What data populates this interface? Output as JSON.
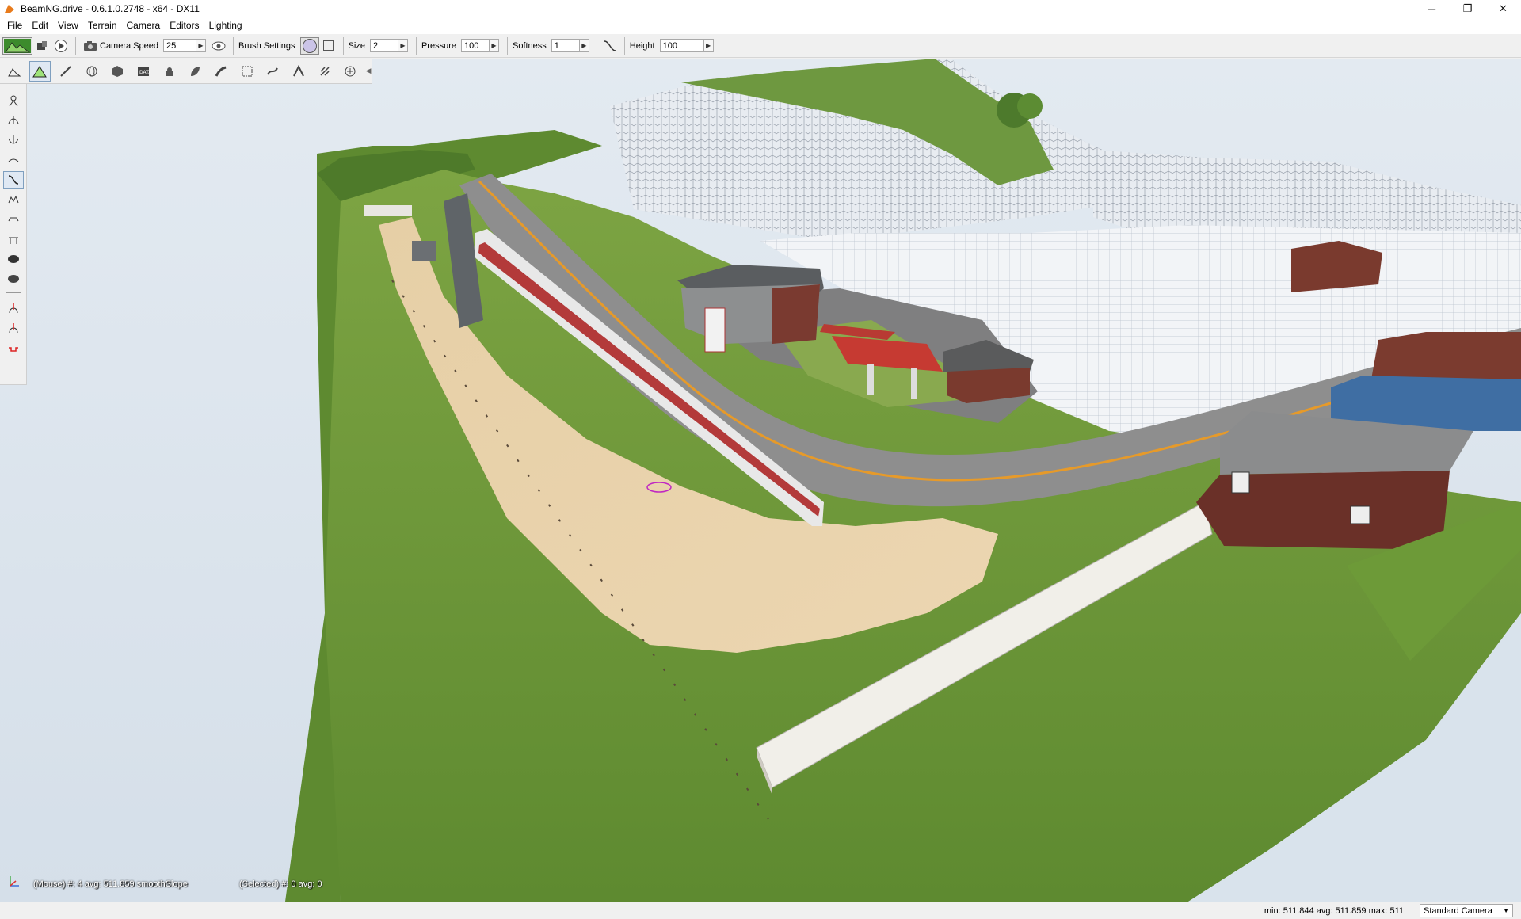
{
  "window": {
    "title": "BeamNG.drive - 0.6.1.0.2748 - x64 - DX11",
    "controls": {
      "minimize": "─",
      "restore": "❐",
      "close": "✕"
    }
  },
  "menu": [
    "File",
    "Edit",
    "View",
    "Terrain",
    "Camera",
    "Editors",
    "Lighting"
  ],
  "toolbar": {
    "camera_speed_label": "Camera Speed",
    "camera_speed_value": "25",
    "brush_settings_label": "Brush Settings",
    "size_label": "Size",
    "size_value": "2",
    "pressure_label": "Pressure",
    "pressure_value": "100",
    "softness_label": "Softness",
    "softness_value": "1",
    "height_label": "Height",
    "height_value": "100"
  },
  "viewport": {
    "mouse_info": "(Mouse) #: 4  avg: 511.859 smoothSlope",
    "selected_info": "(Selected) #: 0  avg: 0"
  },
  "statusbar": {
    "stats": "min: 511.844  avg: 511.859  max: 511",
    "camera_mode": "Standard Camera"
  },
  "colors": {
    "sky": "#d9e3ec",
    "grass": "#6f9a3c",
    "sand": "#e9d3ab",
    "road": "#8b8b8b",
    "road_line": "#e69a2a"
  }
}
